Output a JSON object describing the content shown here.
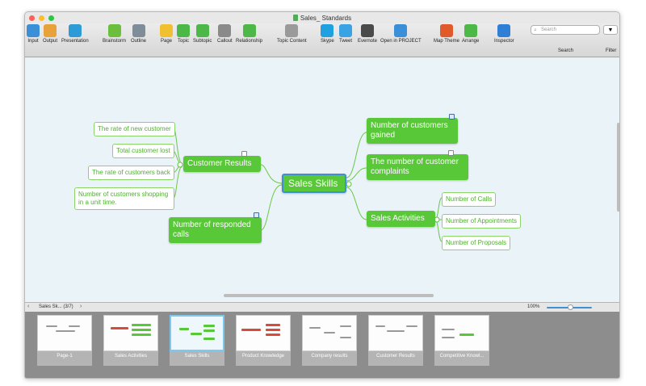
{
  "window": {
    "title": "Sales_ Standards",
    "lights": [
      "#ff5f57",
      "#ffbd2e",
      "#28c940"
    ]
  },
  "toolbar": {
    "items": [
      {
        "label": "Input",
        "icon": "input-icon",
        "color": "#3a8fd8"
      },
      {
        "label": "Output",
        "icon": "output-icon",
        "color": "#e8a23a"
      },
      {
        "label": "Presentation",
        "icon": "presentation-icon",
        "color": "#2f9bd6"
      },
      {
        "label": "Brainstorm",
        "icon": "brainstorm-icon",
        "color": "#6cbf3c"
      },
      {
        "label": "Outline",
        "icon": "outline-icon",
        "color": "#7f8c99"
      },
      {
        "label": "Page",
        "icon": "page-icon",
        "color": "#f0c030"
      },
      {
        "label": "Topic",
        "icon": "topic-icon",
        "color": "#4cb848"
      },
      {
        "label": "Subtopic",
        "icon": "subtopic-icon",
        "color": "#4cb848"
      },
      {
        "label": "Callout",
        "icon": "callout-icon",
        "color": "#8a8a8a"
      },
      {
        "label": "Relationship",
        "icon": "relationship-icon",
        "color": "#4cb848"
      },
      {
        "label": "Topic Content",
        "icon": "topic-content-icon",
        "color": "#9a9a9a"
      },
      {
        "label": "Skype",
        "icon": "skype-icon",
        "color": "#1fa0e0"
      },
      {
        "label": "Tweet",
        "icon": "twitter-icon",
        "color": "#3aa3e3"
      },
      {
        "label": "Evernote",
        "icon": "evernote-icon",
        "color": "#4a4a4a"
      },
      {
        "label": "Open in PROJECT",
        "icon": "project-icon",
        "color": "#3a8fd8"
      },
      {
        "label": "Map Theme",
        "icon": "map-theme-icon",
        "color": "#e05a2a"
      },
      {
        "label": "Arrange",
        "icon": "arrange-icon",
        "color": "#4cb848"
      },
      {
        "label": "Inspector",
        "icon": "inspector-icon",
        "color": "#2f7fd6"
      }
    ],
    "search_placeholder": "Search",
    "search_label": "Search",
    "filter_label": "Filter"
  },
  "map": {
    "central": "Sales Skills",
    "left_topics": [
      {
        "label": "Customer Results"
      },
      {
        "label": "Number of responded calls"
      }
    ],
    "customer_results_subtopics": [
      "The rate of new customer",
      "Total customer lost",
      "The rate of customers back",
      "Number of customers shopping in a unit time."
    ],
    "right_topics": [
      {
        "label": "Number of customers gained"
      },
      {
        "label": "The number of customer complaints"
      },
      {
        "label": "Sales Activities"
      }
    ],
    "sales_activities_subtopics": [
      "Number of Calls",
      "Number of Appointments",
      "Number of Proposals"
    ]
  },
  "status": {
    "page_indicator": "Sales Sk... (3/7)",
    "zoom": "100%"
  },
  "pages": [
    {
      "label": "Page-1"
    },
    {
      "label": "Sales Activities"
    },
    {
      "label": "Sales Skills",
      "active": true
    },
    {
      "label": "Product Knowledge"
    },
    {
      "label": "Company results"
    },
    {
      "label": "Customer Results"
    },
    {
      "label": "Competitive Knowl..."
    }
  ]
}
